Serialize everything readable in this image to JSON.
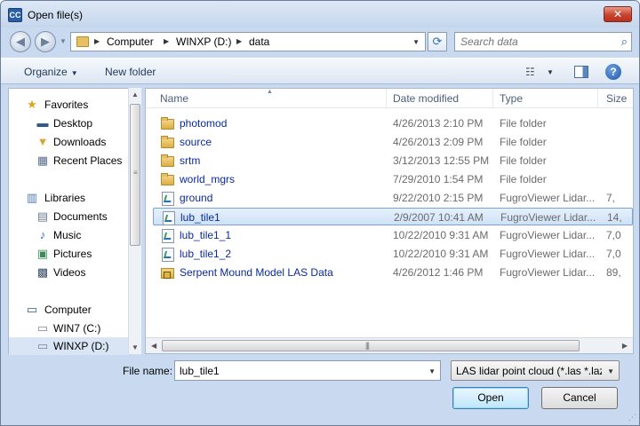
{
  "window": {
    "title": "Open file(s)",
    "app_icon_text": "CC",
    "close_symbol": "✕"
  },
  "address": {
    "crumbs": [
      "Computer",
      "WINXP (D:)",
      "data"
    ],
    "search_placeholder": "Search data"
  },
  "toolbar": {
    "organize_label": "Organize",
    "new_folder_label": "New folder",
    "help_label": "?"
  },
  "sidebar": {
    "items": [
      {
        "label": "Favorites",
        "icon": "star-icon",
        "group": true
      },
      {
        "label": "Desktop",
        "icon": "desktop-icon"
      },
      {
        "label": "Downloads",
        "icon": "downloads-icon"
      },
      {
        "label": "Recent Places",
        "icon": "recent-places-icon"
      },
      {
        "label": "Libraries",
        "icon": "library-icon",
        "group": true
      },
      {
        "label": "Documents",
        "icon": "documents-icon"
      },
      {
        "label": "Music",
        "icon": "music-icon"
      },
      {
        "label": "Pictures",
        "icon": "pictures-icon"
      },
      {
        "label": "Videos",
        "icon": "videos-icon"
      },
      {
        "label": "Computer",
        "icon": "computer-icon",
        "group": true
      },
      {
        "label": "WIN7 (C:)",
        "icon": "drive-icon"
      },
      {
        "label": "WINXP (D:)",
        "icon": "drive-icon",
        "selected": true
      }
    ]
  },
  "columns": {
    "name": "Name",
    "date": "Date modified",
    "type": "Type",
    "size": "Size"
  },
  "files": [
    {
      "name": "photomod",
      "date": "4/26/2013 2:10 PM",
      "type": "File folder",
      "size": "",
      "kind": "folder"
    },
    {
      "name": "source",
      "date": "4/26/2013 2:09 PM",
      "type": "File folder",
      "size": "",
      "kind": "folder"
    },
    {
      "name": "srtm",
      "date": "3/12/2013 12:55 PM",
      "type": "File folder",
      "size": "",
      "kind": "folder"
    },
    {
      "name": "world_mgrs",
      "date": "7/29/2010 1:54 PM",
      "type": "File folder",
      "size": "",
      "kind": "folder"
    },
    {
      "name": "ground",
      "date": "9/22/2010 2:15 PM",
      "type": "FugroViewer Lidar...",
      "size": "7,",
      "kind": "file"
    },
    {
      "name": "lub_tile1",
      "date": "2/9/2007 10:41 AM",
      "type": "FugroViewer Lidar...",
      "size": "14,",
      "kind": "file",
      "selected": true
    },
    {
      "name": "lub_tile1_1",
      "date": "10/22/2010 9:31 AM",
      "type": "FugroViewer Lidar...",
      "size": "7,0",
      "kind": "file"
    },
    {
      "name": "lub_tile1_2",
      "date": "10/22/2010 9:31 AM",
      "type": "FugroViewer Lidar...",
      "size": "7,0",
      "kind": "file"
    },
    {
      "name": "Serpent Mound Model LAS Data",
      "date": "4/26/2012 1:46 PM",
      "type": "FugroViewer Lidar...",
      "size": "89,",
      "kind": "locked"
    }
  ],
  "bottom": {
    "file_name_label": "File name:",
    "file_name_value": "lub_tile1",
    "filter_value": "LAS lidar point cloud (*.las *.laz",
    "open_label": "Open",
    "cancel_label": "Cancel"
  },
  "colors": {
    "accent": "#1f56a7",
    "link_text": "#0a2a9c",
    "selection": "#cfe2f8"
  }
}
